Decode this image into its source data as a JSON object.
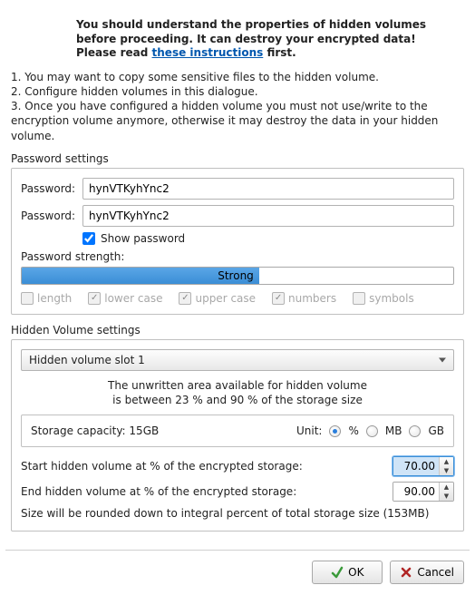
{
  "warning": {
    "text1": "You should understand the properties of hidden volumes before proceeding. It can destroy your encrypted data! Please read ",
    "link": "these instructions",
    "text2": " first."
  },
  "steps": {
    "s1": "1. You may want to copy some sensitive files to the hidden volume.",
    "s2": "2. Configure hidden volumes in this dialogue.",
    "s3": "3. Once you have configured a hidden volume you must not use/write to the encryption volume anymore, otherwise it may destroy the data in your hidden volume."
  },
  "pw": {
    "section": "Password settings",
    "label": "Password:",
    "value": "hynVTKyhYnc2",
    "show_label": "Show password",
    "show_checked": true,
    "strength_label": "Password strength:",
    "strength_text": "Strong",
    "crit": {
      "length": "length",
      "lower": "lower case",
      "upper": "upper case",
      "numbers": "numbers",
      "symbols": "symbols"
    }
  },
  "hv": {
    "section": "Hidden Volume settings",
    "slot_selected": "Hidden volume slot 1",
    "info1": "The unwritten area available for hidden volume",
    "info2": "is between 23 % and 90 % of the storage size",
    "cap_label_prefix": "Storage capacity: ",
    "cap_value": "15GB",
    "unit_label": "Unit:",
    "units": {
      "pct": "%",
      "mb": "MB",
      "gb": "GB"
    },
    "start_label": "Start hidden volume at % of the encrypted storage:",
    "start_value": "70.00",
    "end_label": "End hidden volume at % of the encrypted storage:",
    "end_value": "90.00",
    "note": "Size will be rounded down to integral percent of total storage size (153MB)"
  },
  "buttons": {
    "ok": "OK",
    "cancel": "Cancel"
  }
}
